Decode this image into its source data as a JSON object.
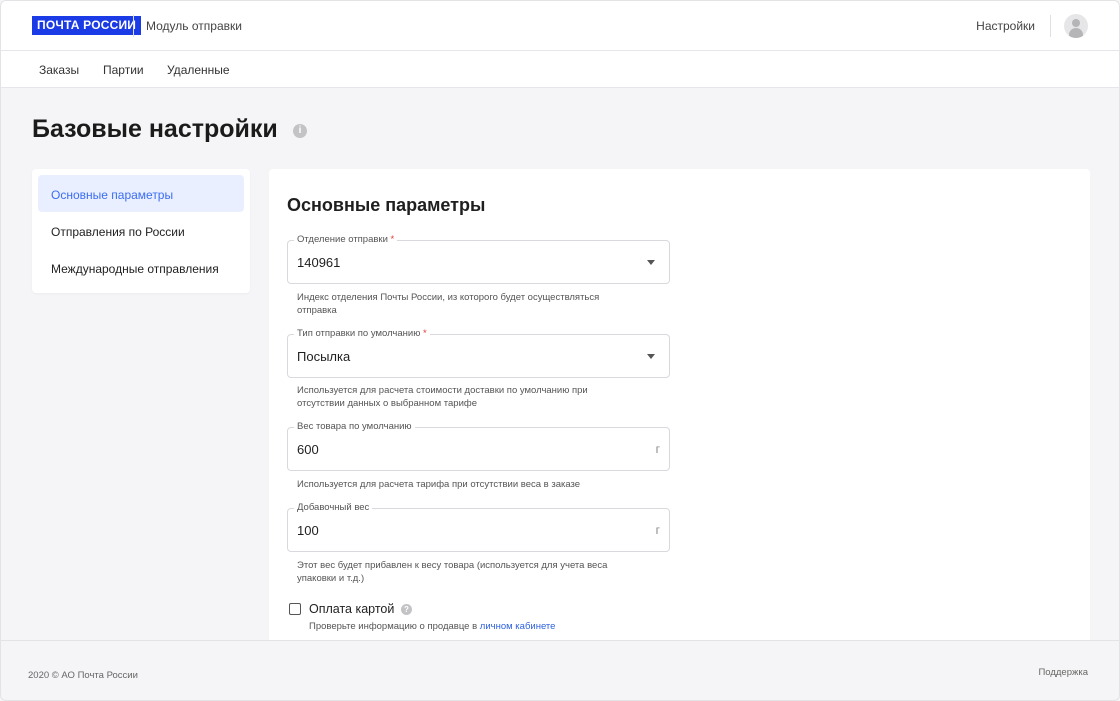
{
  "header": {
    "logo_text": "ПОЧТА РОССИИ",
    "module_title": "Модуль отправки",
    "settings_label": "Настройки",
    "avatar_icon": "user-icon",
    "brand_color": "#1a3be6"
  },
  "nav": {
    "items": [
      {
        "label": "Заказы"
      },
      {
        "label": "Партии"
      },
      {
        "label": "Удаленные"
      }
    ]
  },
  "page": {
    "title": "Базовые настройки",
    "title_icon": "info-icon"
  },
  "sidebar": {
    "items": [
      {
        "label": "Основные параметры",
        "active": true
      },
      {
        "label": "Отправления по России",
        "active": false
      },
      {
        "label": "Международные отправления",
        "active": false
      }
    ],
    "accent_color": "#3b6df2"
  },
  "main": {
    "section_title": "Основные параметры",
    "fields": [
      {
        "label": "Отделение отправки",
        "required_mark": "*",
        "value": "140961",
        "hint": "Индекс отделения Почты России, из которого будет осуществляться отправка"
      },
      {
        "label": "Тип отправки по умолчанию",
        "required_mark": "*",
        "value": "Посылка",
        "hint": "Используется для расчета стоимости доставки по умолчанию при отсутствии данных о выбранном тарифе"
      },
      {
        "label": "Вес товара по умолчанию",
        "value": "600",
        "unit": "г",
        "hint": "Используется для расчета тарифа при отсутствии веса в заказе"
      },
      {
        "label": "Добавочный вес",
        "value": "100",
        "unit": "г",
        "hint": "Этот вес будет прибавлен к весу товара (используется для учета веса упаковки и т.д.)"
      }
    ],
    "card_payment": {
      "label": "Оплата картой",
      "checked": false,
      "hint_text": "Проверьте информацию о продавце в",
      "hint_link": "личном кабинете"
    }
  },
  "footer": {
    "copyright": "2020 © АО Почта России",
    "support": "Поддержка"
  }
}
